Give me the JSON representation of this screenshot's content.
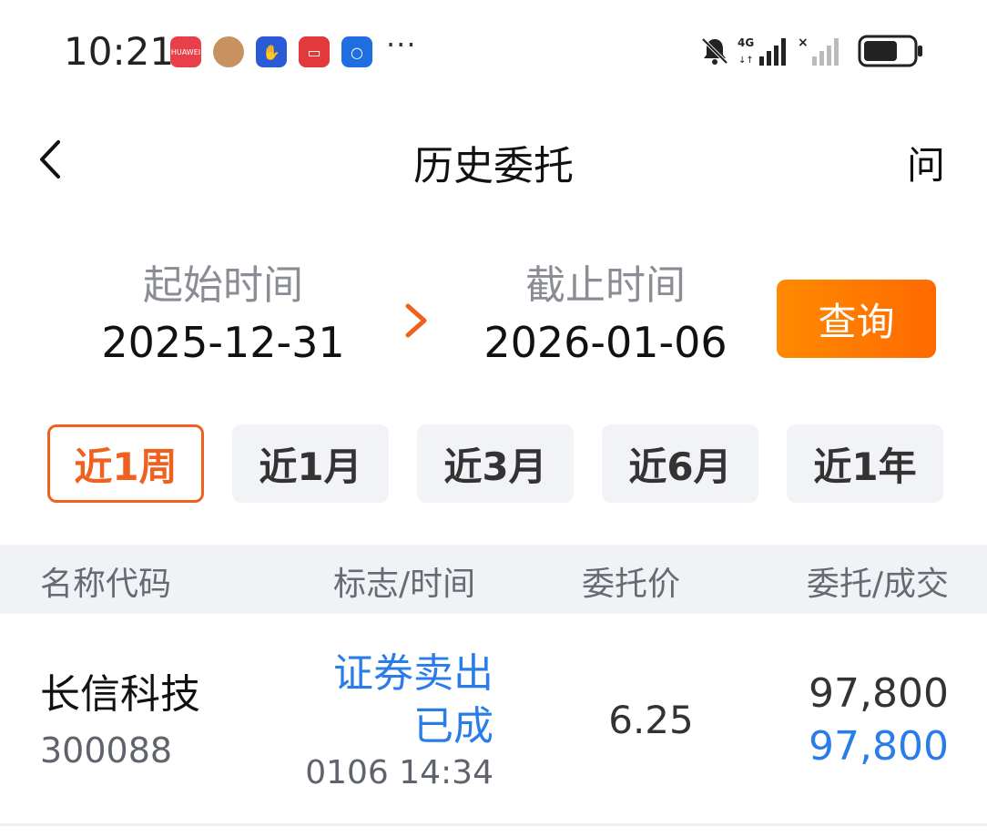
{
  "status_bar": {
    "time": "10:21",
    "app_icon_label": "HUAWEI",
    "more": "···"
  },
  "header": {
    "title": "历史委托",
    "help": "问"
  },
  "date_range": {
    "start_label": "起始时间",
    "start_value": "2025-12-31",
    "end_label": "截止时间",
    "end_value": "2026-01-06",
    "query_label": "查询"
  },
  "periods": [
    {
      "label": "近1周",
      "active": true
    },
    {
      "label": "近1月",
      "active": false
    },
    {
      "label": "近3月",
      "active": false
    },
    {
      "label": "近6月",
      "active": false
    },
    {
      "label": "近1年",
      "active": false
    }
  ],
  "table": {
    "headers": [
      "名称代码",
      "标志/时间",
      "委托价",
      "委托/成交"
    ],
    "rows": [
      {
        "name": "长信科技",
        "code": "300088",
        "action": "证券卖出",
        "status": "已成",
        "time": "0106 14:34",
        "price": "6.25",
        "order_qty": "97,800",
        "filled_qty": "97,800"
      }
    ]
  },
  "colors": {
    "accent": "#ff6a00",
    "active_chip": "#f0601e",
    "link_blue": "#2a7de9"
  }
}
